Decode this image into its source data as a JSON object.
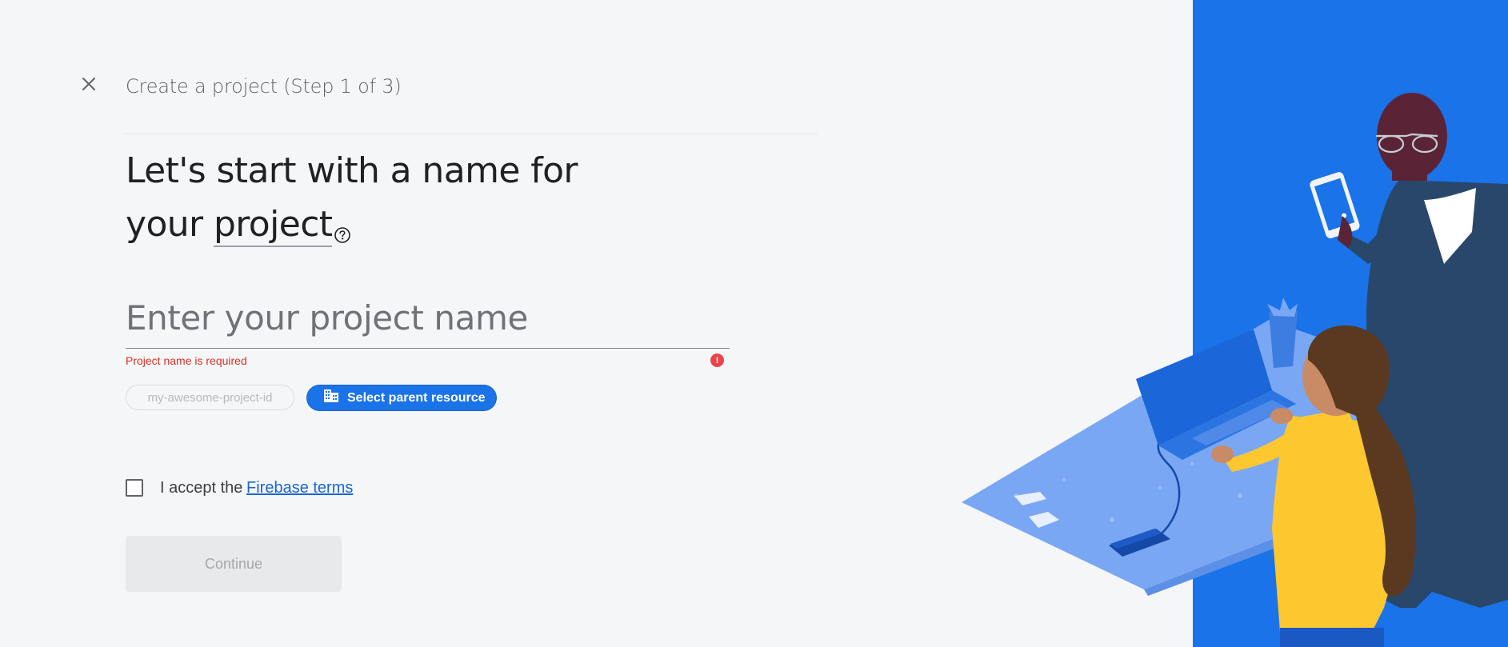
{
  "header": {
    "close_icon": "close-icon",
    "step_title": "Create a project (Step 1 of 3)"
  },
  "main": {
    "heading_line1": "Let's start with a name for",
    "heading_line2_prefix": "your ",
    "heading_term": "project",
    "help_icon": "help-circle-icon",
    "project_name": {
      "value": "",
      "placeholder": "Enter your project name"
    },
    "error": {
      "message": "Project name is required",
      "icon": "error-icon",
      "icon_glyph": "!"
    },
    "project_id_placeholder": "my-awesome-project-id",
    "parent_button": {
      "label": "Select parent resource",
      "icon": "domain-icon"
    },
    "terms": {
      "checked": false,
      "prefix": "I accept the",
      "link": "Firebase terms"
    },
    "continue_label": "Continue"
  },
  "colors": {
    "accent": "#1a73e8",
    "error": "#d93025",
    "illustration_bg": "#1a73e8"
  }
}
